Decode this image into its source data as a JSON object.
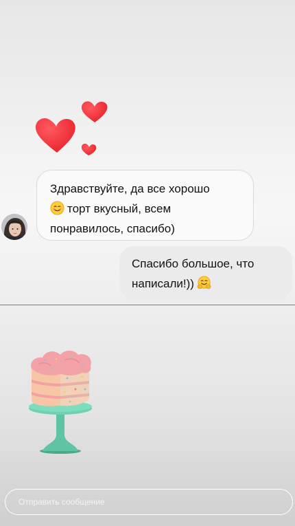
{
  "sticker": {
    "icon": "hearts-icon",
    "color": "#f0323a"
  },
  "conversation": {
    "incoming": {
      "lines": [
        "Здравствуйте, да все хорошо",
        "торт вкусный, всем",
        "понравилось, спасибо)"
      ],
      "emoji": "smiling-face-icon",
      "bubble_color": "#fafafa"
    },
    "outgoing": {
      "lines": [
        "Спасибо большое, что",
        "написали!))"
      ],
      "emoji": "hugging-face-icon",
      "bubble_color": "#ebebeb"
    }
  },
  "cake_sticker": {
    "icon": "cake-on-stand-icon",
    "stand_color": "#5fc3a5",
    "frosting_color": "#f3a3a8"
  },
  "reply": {
    "placeholder": "Отправить сообщение"
  }
}
